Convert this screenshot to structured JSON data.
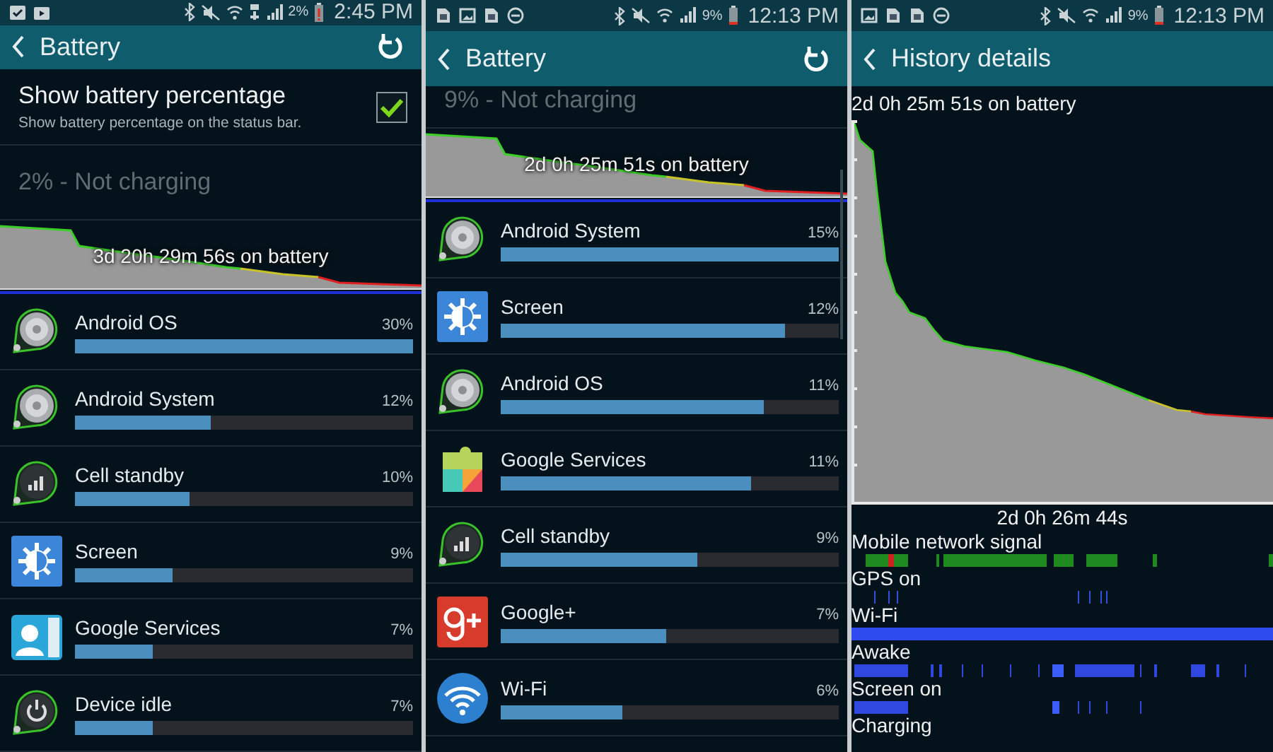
{
  "screens": [
    {
      "status_bar": {
        "notifications": [
          {
            "kind": "clipboard"
          },
          {
            "kind": "bag"
          }
        ],
        "lte_icon": true,
        "battery_text": "2%",
        "battery_low": true,
        "time": "2:45 PM"
      },
      "app_bar": {
        "title": "Battery",
        "refresh_button": true
      },
      "sections": [
        {
          "kind": "checkbox",
          "title": "Show battery percentage",
          "summary": "Show battery percentage on the status bar.",
          "checked": true
        },
        {
          "kind": "status",
          "text": "2% - Not charging"
        },
        {
          "kind": "graph",
          "caption": "3d 20h 29m 56s on battery"
        },
        {
          "kind": "usage",
          "items": [
            {
              "kind": "system",
              "name": "Android OS",
              "percent": "30%",
              "level": 1.0
            },
            {
              "kind": "system",
              "name": "Android System",
              "percent": "12%",
              "level": 0.4
            },
            {
              "kind": "cell",
              "name": "Cell standby",
              "percent": "10%",
              "level": 0.34
            },
            {
              "kind": "screen",
              "name": "Screen",
              "percent": "9%",
              "level": 0.29
            },
            {
              "kind": "contacts",
              "name": "Google Services",
              "percent": "7%",
              "level": 0.23
            },
            {
              "kind": "power",
              "name": "Device idle",
              "percent": "7%",
              "level": 0.23
            }
          ]
        }
      ]
    },
    {
      "status_bar": {
        "notifications": [
          {
            "kind": "sim"
          },
          {
            "kind": "image"
          },
          {
            "kind": "sim"
          },
          {
            "kind": "dnd"
          }
        ],
        "lte_icon": false,
        "battery_text": "9%",
        "battery_low": false,
        "time": "12:13 PM"
      },
      "app_bar": {
        "title": "Battery",
        "refresh_button": true
      },
      "sections": [
        {
          "kind": "status-short",
          "text": "9% - Not charging"
        },
        {
          "kind": "graph",
          "caption": "2d 0h 25m 51s on battery"
        },
        {
          "kind": "usage",
          "items": [
            {
              "kind": "system",
              "name": "Android System",
              "percent": "15%",
              "level": 1.0
            },
            {
              "kind": "screen",
              "name": "Screen",
              "percent": "12%",
              "level": 0.84
            },
            {
              "kind": "system",
              "name": "Android OS",
              "percent": "11%",
              "level": 0.78
            },
            {
              "kind": "puzzle",
              "name": "Google Services",
              "percent": "11%",
              "level": 0.74
            },
            {
              "kind": "cell",
              "name": "Cell standby",
              "percent": "9%",
              "level": 0.58
            },
            {
              "kind": "gplus",
              "name": "Google+",
              "percent": "7%",
              "level": 0.49
            },
            {
              "kind": "wifi",
              "name": "Wi-Fi",
              "percent": "6%",
              "level": 0.36
            }
          ]
        }
      ]
    },
    {
      "status_bar": {
        "notifications": [
          {
            "kind": "image"
          },
          {
            "kind": "sim"
          },
          {
            "kind": "sim"
          },
          {
            "kind": "dnd"
          }
        ],
        "lte_icon": false,
        "battery_text": "9%",
        "battery_low": false,
        "time": "12:13 PM"
      },
      "app_bar": {
        "title": "History details",
        "refresh_button": false
      },
      "sections": [
        {
          "kind": "history",
          "caption": "2d 0h 25m 51s on battery",
          "duration": "2d 0h 26m 44s",
          "timelines": [
            {
              "kind": "signal",
              "label": "Mobile network signal"
            },
            {
              "kind": "gps",
              "label": "GPS on"
            },
            {
              "kind": "wifi",
              "label": "Wi-Fi"
            },
            {
              "kind": "awake",
              "label": "Awake"
            },
            {
              "kind": "screen",
              "label": "Screen on"
            },
            {
              "kind": "charging",
              "label": "Charging"
            }
          ]
        }
      ]
    }
  ]
}
